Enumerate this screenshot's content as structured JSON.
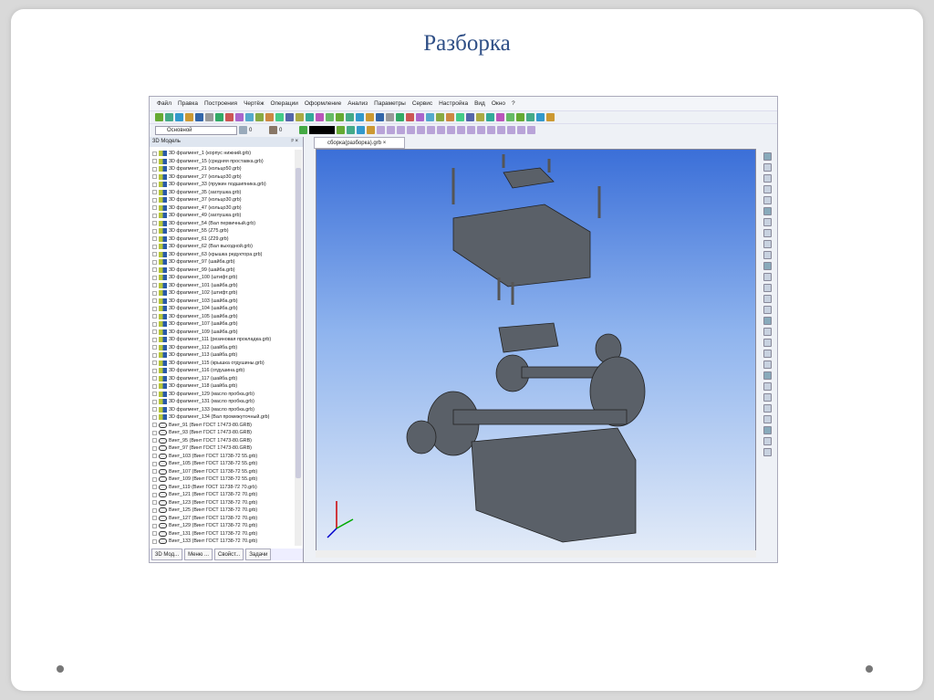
{
  "slide": {
    "title": "Разборка"
  },
  "menu": [
    "Файл",
    "Правка",
    "Построения",
    "Чертёж",
    "Операции",
    "Оформление",
    "Анализ",
    "Параметры",
    "Сервис",
    "Настройка",
    "Вид",
    "Окно",
    "?"
  ],
  "toolbar": {
    "layer_select": "Основной",
    "field1": "0",
    "field2": "0"
  },
  "panel": {
    "title": "3D Модель",
    "pin": "ᵖ ×"
  },
  "tree": [
    "3D фрагмент_1 (корпус нижний.grb)",
    "3D фрагмент_15 (средняя проставка.grb)",
    "3D фрагмент_21 (кольцо50.grb)",
    "3D фрагмент_27 (кольцо30.grb)",
    "3D фрагмент_33 (пружин подшипника.grb)",
    "3D фрагмент_35 (заглушка.grb)",
    "3D фрагмент_37 (кольцо30.grb)",
    "3D фрагмент_47 (кольцо30.grb)",
    "3D фрагмент_49 (заглушка.grb)",
    "3D фрагмент_54 (Вал первичный.grb)",
    "3D фрагмент_55 (Z75.grb)",
    "3D фрагмент_61 (Z29.grb)",
    "3D фрагмент_62 (Вал выходной.grb)",
    "3D фрагмент_63 (крышка редуктора.grb)",
    "3D фрагмент_97 (шайба.grb)",
    "3D фрагмент_99 (шайба.grb)",
    "3D фрагмент_100 (штифт.grb)",
    "3D фрагмент_101 (шайба.grb)",
    "3D фрагмент_102 (штифт.grb)",
    "3D фрагмент_103 (шайба.grb)",
    "3D фрагмент_104 (шайба.grb)",
    "3D фрагмент_105 (шайба.grb)",
    "3D фрагмент_107 (шайба.grb)",
    "3D фрагмент_109 (шайба.grb)",
    "3D фрагмент_111 (резиновая прокладка.grb)",
    "3D фрагмент_112 (шайба.grb)",
    "3D фрагмент_113 (шайба.grb)",
    "3D фрагмент_115 (крышка отдушины.grb)",
    "3D фрагмент_116 (отдушина.grb)",
    "3D фрагмент_117 (шайба.grb)",
    "3D фрагмент_118 (шайба.grb)",
    "3D фрагмент_129 (масло пробка.grb)",
    "3D фрагмент_131 (масло пробка.grb)",
    "3D фрагмент_133 (масло пробка.grb)",
    "3D фрагмент_134 (Вал промежуточный.grb)"
  ],
  "screws": [
    "Винт_91 (Винт ГОСТ 17473-80.GRB)",
    "Винт_93 (Винт ГОСТ 17473-80.GRB)",
    "Винт_95 (Винт ГОСТ 17473-80.GRB)",
    "Винт_97 (Винт ГОСТ 17473-80.GRB)",
    "Винт_103 (Винт ГОСТ 11738-72 55.grb)",
    "Винт_105 (Винт ГОСТ 11738-72 55.grb)",
    "Винт_107 (Винт ГОСТ 11738-72 55.grb)",
    "Винт_109 (Винт ГОСТ 11738-72 55.grb)",
    "Винт_119 (Винт ГОСТ 11738-72 70.grb)",
    "Винт_121 (Винт ГОСТ 11738-72 70.grb)",
    "Винт_123 (Винт ГОСТ 11738-72 70.grb)",
    "Винт_125 (Винт ГОСТ 11738-72 70.grb)",
    "Винт_127 (Винт ГОСТ 11738-72 70.grb)",
    "Винт_129 (Винт ГОСТ 11738-72 70.grb)",
    "Винт_131 (Винт ГОСТ 11738-72 70.grb)",
    "Винт_133 (Винт ГОСТ 11738-72 70.grb)"
  ],
  "bottom_tabs": [
    "3D Мод...",
    "Меню ...",
    "Свойст...",
    "Задачи"
  ],
  "document_tab": "сборка(разборка).grb ×"
}
